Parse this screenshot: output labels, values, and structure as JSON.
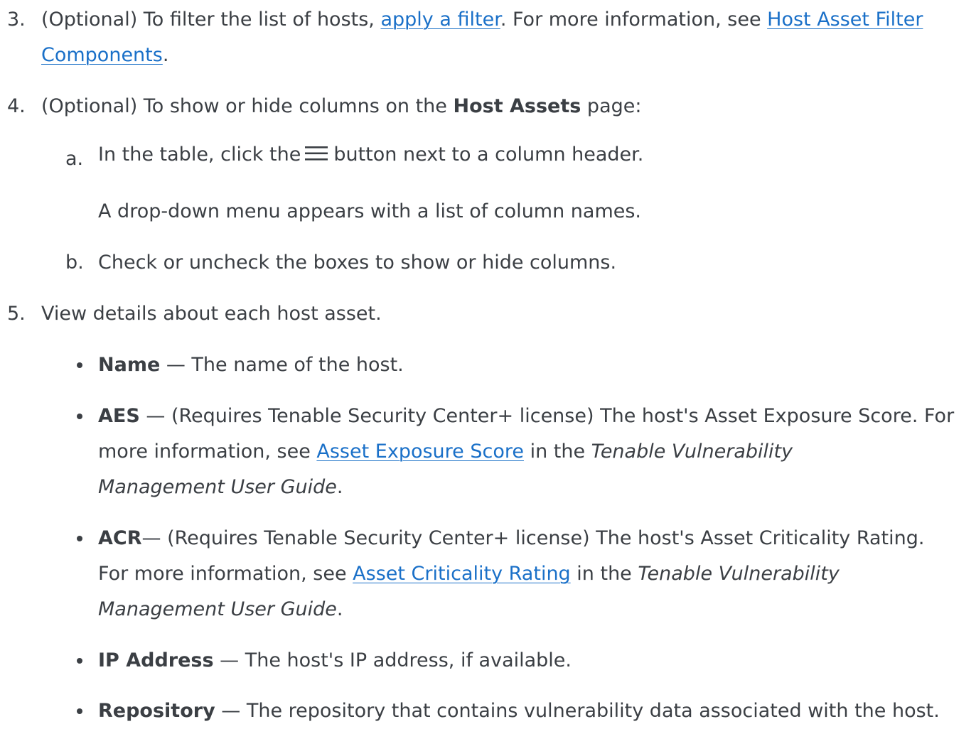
{
  "steps": {
    "step3": {
      "number": "3.",
      "text1": "(Optional) To filter the list of hosts, ",
      "link1": "apply a filter",
      "text2": ". For more information, see ",
      "link2a": "Host Asset Filter",
      "link2b": "Components",
      "text3": "."
    },
    "step4": {
      "number": "4.",
      "text1": "(Optional) To show or hide columns on the ",
      "bold": "Host Assets",
      "text2": " page:",
      "sub_a": {
        "label": "a.",
        "text1": "In the table, click the",
        "icon": "hamburger-menu-icon",
        "text2": "button next to a column header.",
        "note": "A drop-down menu appears with a list of column names."
      },
      "sub_b": {
        "label": "b.",
        "text": "Check or uncheck the boxes to show or hide columns."
      }
    },
    "step5": {
      "number": "5.",
      "text": "View details about each host asset.",
      "bullets": [
        {
          "term": "Name",
          "line1": " — The name of the host."
        },
        {
          "term": "AES",
          "line1": " — (Requires Tenable Security Center+ license) The host's Asset Exposure Score. For",
          "line2_pre": "more information, see ",
          "line2_link": "Asset Exposure Score",
          "line2_mid": " in the ",
          "line2_italic": "Tenable Vulnerability",
          "line3_italic": "Management User Guide",
          "line3_post": "."
        },
        {
          "term": "ACR",
          "line1": "— (Requires Tenable Security Center+ license) The host's Asset Criticality Rating.",
          "line2_pre": "For more information, see ",
          "line2_link": "Asset Criticality Rating",
          "line2_mid": " in the ",
          "line2_italic": "Tenable Vulnerability",
          "line3_italic": "Management User Guide",
          "line3_post": "."
        },
        {
          "term": "IP Address",
          "line1": " — The host's IP address, if available."
        },
        {
          "term": "Repository",
          "line1": " — The repository that contains vulnerability data associated with the host."
        }
      ]
    }
  },
  "colors": {
    "text": "#3b3f44",
    "link": "#1a70c8"
  }
}
